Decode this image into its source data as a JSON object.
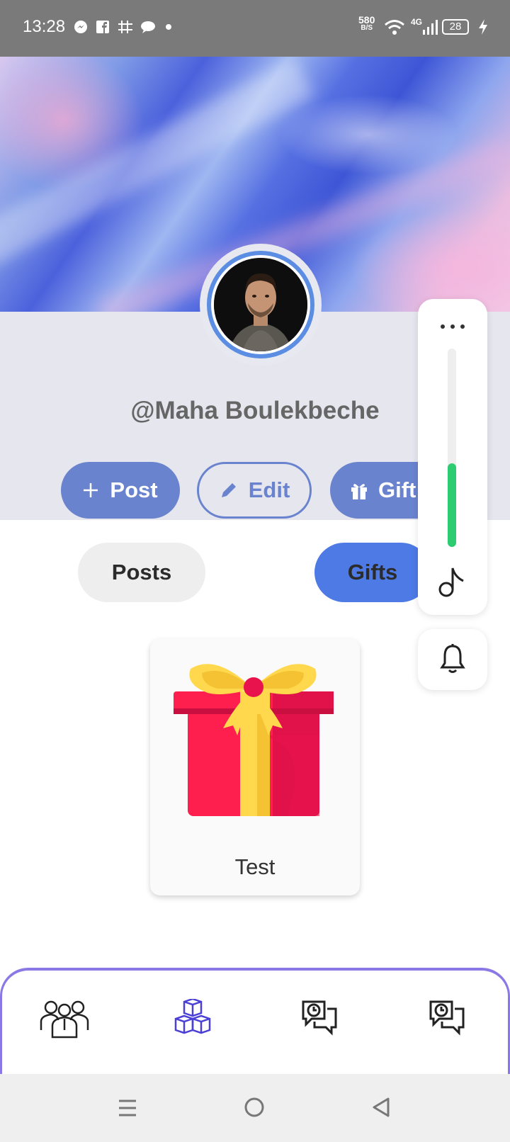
{
  "status_bar": {
    "time": "13:28",
    "net_speed_value": "580",
    "net_speed_unit": "B/S",
    "network": "4G",
    "battery": "28"
  },
  "profile": {
    "username": "@Maha Boulekbeche"
  },
  "actions": {
    "post_label": "Post",
    "edit_label": "Edit",
    "gift_label": "Gift"
  },
  "tabs": {
    "posts_label": "Posts",
    "gifts_label": "Gifts",
    "active": "Gifts"
  },
  "volume_panel": {
    "level": 0.42,
    "accent": "#2ecc71"
  },
  "gifts": [
    {
      "name": "Test"
    }
  ],
  "bottom_nav": {
    "items": [
      "people-group-icon",
      "cubes-icon",
      "chat-clock-icon",
      "chat-clock-icon"
    ],
    "active_index": 1,
    "accent": "#4a3fd6"
  },
  "colors": {
    "primary_button": "#6a83cf",
    "active_tab": "#4e7ae6",
    "avatar_ring": "#5b8de3"
  }
}
